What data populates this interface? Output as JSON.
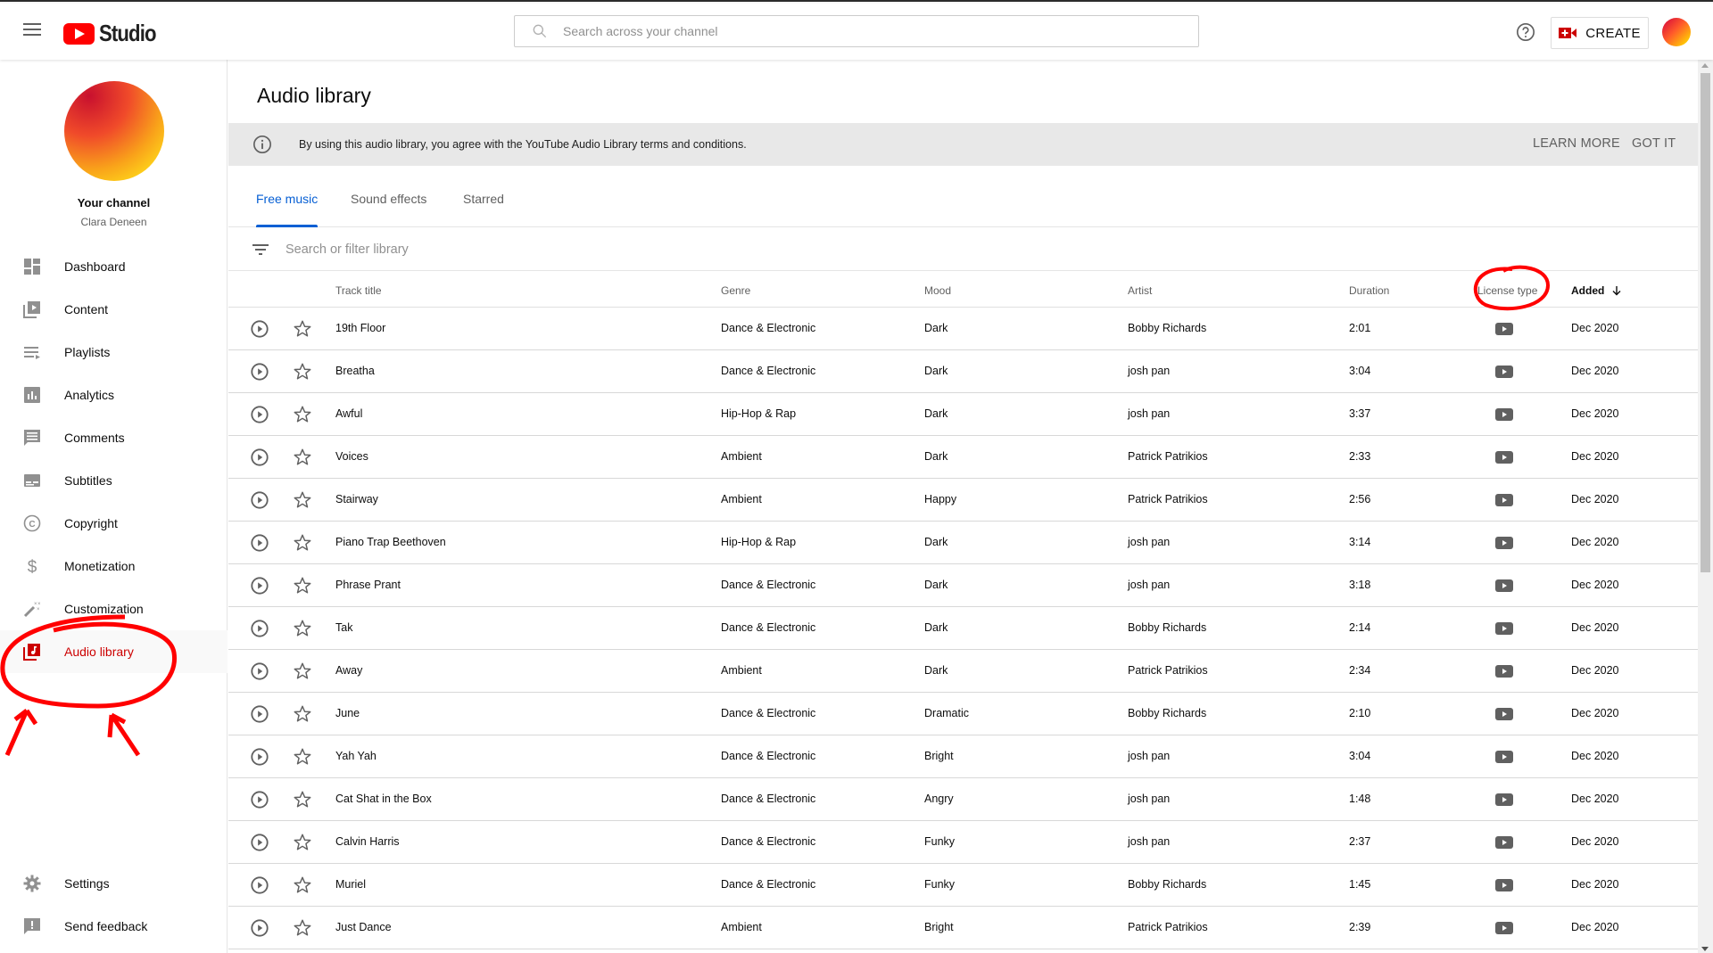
{
  "header": {
    "logo_text": "Studio",
    "search_placeholder": "Search across your channel",
    "create_label": "CREATE",
    "help_icon": "help-circle-icon",
    "account_icon": "avatar"
  },
  "sidebar": {
    "channel_title": "Your channel",
    "channel_name": "Clara Deneen",
    "items": [
      {
        "label": "Dashboard",
        "icon": "dashboard-icon"
      },
      {
        "label": "Content",
        "icon": "content-icon"
      },
      {
        "label": "Playlists",
        "icon": "playlists-icon"
      },
      {
        "label": "Analytics",
        "icon": "analytics-icon"
      },
      {
        "label": "Comments",
        "icon": "comments-icon"
      },
      {
        "label": "Subtitles",
        "icon": "subtitles-icon"
      },
      {
        "label": "Copyright",
        "icon": "copyright-icon"
      },
      {
        "label": "Monetization",
        "icon": "dollar-icon"
      },
      {
        "label": "Customization",
        "icon": "magic-wand-icon"
      },
      {
        "label": "Audio library",
        "icon": "audio-library-icon",
        "active": true
      }
    ],
    "bottom_items": [
      {
        "label": "Settings",
        "icon": "gear-icon"
      },
      {
        "label": "Send feedback",
        "icon": "feedback-icon"
      }
    ]
  },
  "main": {
    "title": "Audio library",
    "banner": {
      "text": "By using this audio library, you agree with the YouTube Audio Library terms and conditions.",
      "learn_more": "LEARN MORE",
      "got_it": "GOT IT"
    },
    "tabs": [
      {
        "label": "Free music",
        "active": true
      },
      {
        "label": "Sound effects"
      },
      {
        "label": "Starred"
      }
    ],
    "filter_placeholder": "Search or filter library",
    "columns": {
      "title": "Track title",
      "genre": "Genre",
      "mood": "Mood",
      "artist": "Artist",
      "duration": "Duration",
      "license": "License type",
      "added": "Added",
      "sort_indicator": "arrow-down-icon"
    },
    "tracks": [
      {
        "title": "19th Floor",
        "genre": "Dance & Electronic",
        "mood": "Dark",
        "artist": "Bobby Richards",
        "duration": "2:01",
        "added": "Dec 2020"
      },
      {
        "title": "Breatha",
        "genre": "Dance & Electronic",
        "mood": "Dark",
        "artist": "josh pan",
        "duration": "3:04",
        "added": "Dec 2020"
      },
      {
        "title": "Awful",
        "genre": "Hip-Hop & Rap",
        "mood": "Dark",
        "artist": "josh pan",
        "duration": "3:37",
        "added": "Dec 2020"
      },
      {
        "title": "Voices",
        "genre": "Ambient",
        "mood": "Dark",
        "artist": "Patrick Patrikios",
        "duration": "2:33",
        "added": "Dec 2020"
      },
      {
        "title": "Stairway",
        "genre": "Ambient",
        "mood": "Happy",
        "artist": "Patrick Patrikios",
        "duration": "2:56",
        "added": "Dec 2020"
      },
      {
        "title": "Piano Trap Beethoven",
        "genre": "Hip-Hop & Rap",
        "mood": "Dark",
        "artist": "josh pan",
        "duration": "3:14",
        "added": "Dec 2020"
      },
      {
        "title": "Phrase Prant",
        "genre": "Dance & Electronic",
        "mood": "Dark",
        "artist": "josh pan",
        "duration": "3:18",
        "added": "Dec 2020"
      },
      {
        "title": "Tak",
        "genre": "Dance & Electronic",
        "mood": "Dark",
        "artist": "Bobby Richards",
        "duration": "2:14",
        "added": "Dec 2020"
      },
      {
        "title": "Away",
        "genre": "Ambient",
        "mood": "Dark",
        "artist": "Patrick Patrikios",
        "duration": "2:34",
        "added": "Dec 2020"
      },
      {
        "title": "June",
        "genre": "Dance & Electronic",
        "mood": "Dramatic",
        "artist": "Bobby Richards",
        "duration": "2:10",
        "added": "Dec 2020"
      },
      {
        "title": "Yah Yah",
        "genre": "Dance & Electronic",
        "mood": "Bright",
        "artist": "josh pan",
        "duration": "3:04",
        "added": "Dec 2020"
      },
      {
        "title": "Cat Shat in the Box",
        "genre": "Dance & Electronic",
        "mood": "Angry",
        "artist": "josh pan",
        "duration": "1:48",
        "added": "Dec 2020"
      },
      {
        "title": "Calvin Harris",
        "genre": "Dance & Electronic",
        "mood": "Funky",
        "artist": "josh pan",
        "duration": "2:37",
        "added": "Dec 2020"
      },
      {
        "title": "Muriel",
        "genre": "Dance & Electronic",
        "mood": "Funky",
        "artist": "Bobby Richards",
        "duration": "1:45",
        "added": "Dec 2020"
      },
      {
        "title": "Just Dance",
        "genre": "Ambient",
        "mood": "Bright",
        "artist": "Patrick Patrikios",
        "duration": "2:39",
        "added": "Dec 2020"
      }
    ]
  },
  "colors": {
    "brand_red": "#ff0000",
    "active_nav": "#cc0000",
    "active_tab": "#065fd4",
    "annotation": "#ff0000"
  }
}
